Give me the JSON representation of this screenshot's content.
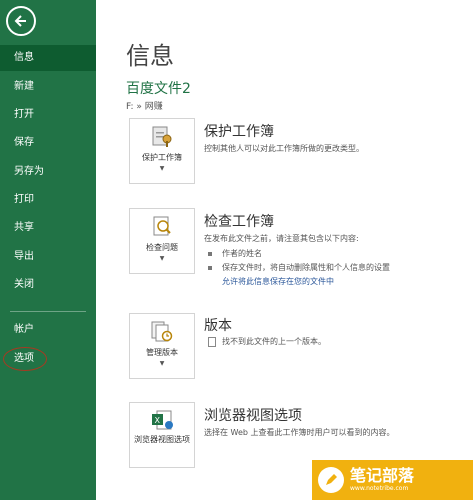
{
  "sidebar": {
    "items": [
      {
        "label": "信息"
      },
      {
        "label": "新建"
      },
      {
        "label": "打开"
      },
      {
        "label": "保存"
      },
      {
        "label": "另存为"
      },
      {
        "label": "打印"
      },
      {
        "label": "共享"
      },
      {
        "label": "导出"
      },
      {
        "label": "关闭"
      },
      {
        "label": "帐户"
      },
      {
        "label": "选项"
      }
    ]
  },
  "main": {
    "title": "信息",
    "doc_name": "百度文件2",
    "doc_path": "F: » 网赚",
    "protect": {
      "tile_label": "保护工作簿",
      "title": "保护工作簿",
      "desc": "控制其他人可以对此工作簿所做的更改类型。"
    },
    "inspect": {
      "tile_label": "检查问题",
      "title": "检查工作簿",
      "desc": "在发布此文件之前，请注意其包含以下内容:",
      "bullets": [
        "作者的姓名",
        "保存文件时，将自动删除属性和个人信息的设置"
      ],
      "link": "允许将此信息保存在您的文件中"
    },
    "versions": {
      "tile_label": "管理版本",
      "title": "版本",
      "desc": "找不到此文件的上一个版本。"
    },
    "browser": {
      "tile_label": "浏览器视图选项",
      "title": "浏览器视图选项",
      "desc": "选择在 Web 上查看此工作簿时用户可以看到的内容。"
    }
  },
  "watermark": {
    "title": "笔记部落",
    "url": "www.notetribe.com"
  },
  "colors": {
    "accent": "#217346",
    "active": "#0e5c30",
    "link": "#2b579a",
    "watermark": "#f1b10f"
  }
}
